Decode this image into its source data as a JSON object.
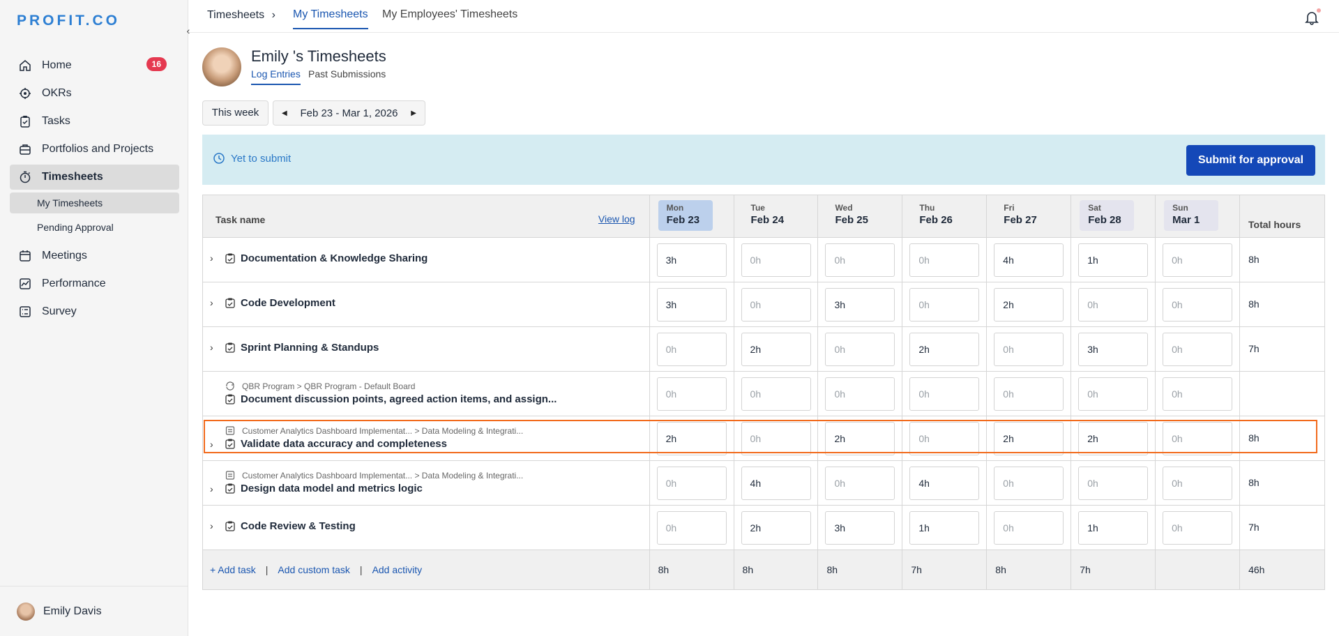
{
  "brand": {
    "logo": "PROFIT.CO"
  },
  "sidebar": {
    "items": [
      {
        "label": "Home",
        "icon": "home-icon",
        "badge": "16"
      },
      {
        "label": "OKRs",
        "icon": "target-icon"
      },
      {
        "label": "Tasks",
        "icon": "clipboard-icon"
      },
      {
        "label": "Portfolios and Projects",
        "icon": "briefcase-icon"
      },
      {
        "label": "Timesheets",
        "icon": "stopwatch-icon",
        "active": true
      },
      {
        "label": "Meetings",
        "icon": "calendar-icon"
      },
      {
        "label": "Performance",
        "icon": "chart-icon"
      },
      {
        "label": "Survey",
        "icon": "survey-icon"
      }
    ],
    "subitems": [
      {
        "label": "My Timesheets",
        "active": true
      },
      {
        "label": "Pending Approval"
      }
    ],
    "user": "Emily Davis"
  },
  "topbar": {
    "crumb": "Timesheets",
    "crumb_sep": "›",
    "tabs": [
      "My Timesheets",
      "My Employees' Timesheets"
    ]
  },
  "header": {
    "title": "Emily 's Timesheets",
    "subtabs": [
      "Log Entries",
      "Past Submissions"
    ],
    "this_week": "This week",
    "date_range": "Feb 23 - Mar 1, 2026"
  },
  "status": {
    "text": "Yet to submit",
    "submit_label": "Submit for approval"
  },
  "table": {
    "task_header": "Task name",
    "view_log": "View log",
    "total_header": "Total hours",
    "days": [
      {
        "name": "Mon",
        "date": "Feb 23"
      },
      {
        "name": "Tue",
        "date": "Feb 24"
      },
      {
        "name": "Wed",
        "date": "Feb 25"
      },
      {
        "name": "Thu",
        "date": "Feb 26"
      },
      {
        "name": "Fri",
        "date": "Feb 27"
      },
      {
        "name": "Sat",
        "date": "Feb 28"
      },
      {
        "name": "Sun",
        "date": "Mar 1"
      }
    ],
    "rows": [
      {
        "name": "Documentation & Knowledge Sharing",
        "hours": [
          "3h",
          "0h",
          "0h",
          "0h",
          "4h",
          "1h",
          "0h"
        ],
        "total": "8h"
      },
      {
        "name": "Code Development",
        "hours": [
          "3h",
          "0h",
          "3h",
          "0h",
          "2h",
          "0h",
          "0h"
        ],
        "total": "8h"
      },
      {
        "name": "Sprint Planning & Standups",
        "hours": [
          "0h",
          "2h",
          "0h",
          "2h",
          "0h",
          "3h",
          "0h"
        ],
        "total": "7h"
      },
      {
        "crumb": "QBR Program > QBR Program - Default Board",
        "name": "Document discussion points, agreed action items, and assign...",
        "hours": [
          "0h",
          "0h",
          "0h",
          "0h",
          "0h",
          "0h",
          "0h"
        ],
        "total": ""
      },
      {
        "crumb": "Customer Analytics Dashboard Implementat... > Data Modeling & Integrati...",
        "name": "Validate data accuracy and completeness",
        "hours": [
          "2h",
          "0h",
          "2h",
          "0h",
          "2h",
          "2h",
          "0h"
        ],
        "total": "8h"
      },
      {
        "crumb": "Customer Analytics Dashboard Implementat... > Data Modeling & Integrati...",
        "name": "Design data model and metrics logic",
        "hours": [
          "0h",
          "4h",
          "0h",
          "4h",
          "0h",
          "0h",
          "0h"
        ],
        "total": "8h"
      },
      {
        "name": "Code Review & Testing",
        "hours": [
          "0h",
          "2h",
          "3h",
          "1h",
          "0h",
          "1h",
          "0h"
        ],
        "total": "7h"
      }
    ],
    "footer": {
      "add_task": "+ Add task",
      "add_custom": "Add custom task",
      "add_activity": "Add activity",
      "totals": [
        "8h",
        "8h",
        "8h",
        "7h",
        "8h",
        "7h",
        "",
        "46h"
      ]
    }
  }
}
